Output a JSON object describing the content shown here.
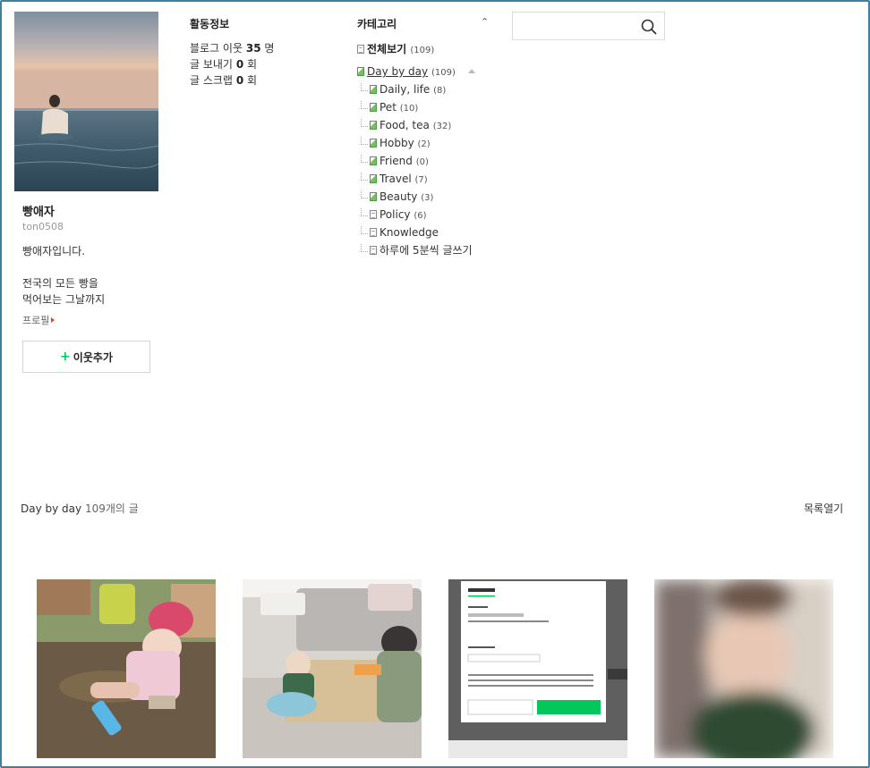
{
  "profile": {
    "name": "빵애자",
    "id": "ton0508",
    "intro": "빵애자입니다.",
    "desc_line1": "전국의 모든 빵을",
    "desc_line2": "먹어보는 그날까지",
    "link_label": "프로필",
    "add_neighbor_label": "이웃추가",
    "add_neighbor_plus": "+"
  },
  "activity": {
    "title": "활동정보",
    "neighbors_label": "블로그 이웃",
    "neighbors_count": "35",
    "neighbors_unit": "명",
    "send_label": "글 보내기",
    "send_count": "0",
    "send_unit": "회",
    "scrap_label": "글 스크랩",
    "scrap_count": "0",
    "scrap_unit": "회"
  },
  "category": {
    "title": "카테고리",
    "toggle": "⌃",
    "all_label": "전체보기",
    "all_count": "(109)",
    "parent_label": "Day by day",
    "parent_count": "(109)",
    "children": [
      {
        "label": "Daily, life",
        "count": "(8)"
      },
      {
        "label": "Pet",
        "count": "(10)"
      },
      {
        "label": "Food, tea",
        "count": "(32)"
      },
      {
        "label": "Hobby",
        "count": "(2)"
      },
      {
        "label": "Friend",
        "count": "(0)"
      },
      {
        "label": "Travel",
        "count": "(7)"
      },
      {
        "label": "Beauty",
        "count": "(3)"
      },
      {
        "label": "Policy",
        "count": "(6)"
      },
      {
        "label": "Knowledge",
        "count": ""
      },
      {
        "label": "하루에 5분씩 글쓰기",
        "count": ""
      }
    ]
  },
  "search": {
    "placeholder": ""
  },
  "posts": {
    "category": "Day by day",
    "count_text": "109개의 글",
    "list_open": "목록열기"
  },
  "colors": {
    "accent_green": "#03c75a",
    "link_arrow": "#e04a18",
    "frame": "#3f7fa0"
  }
}
